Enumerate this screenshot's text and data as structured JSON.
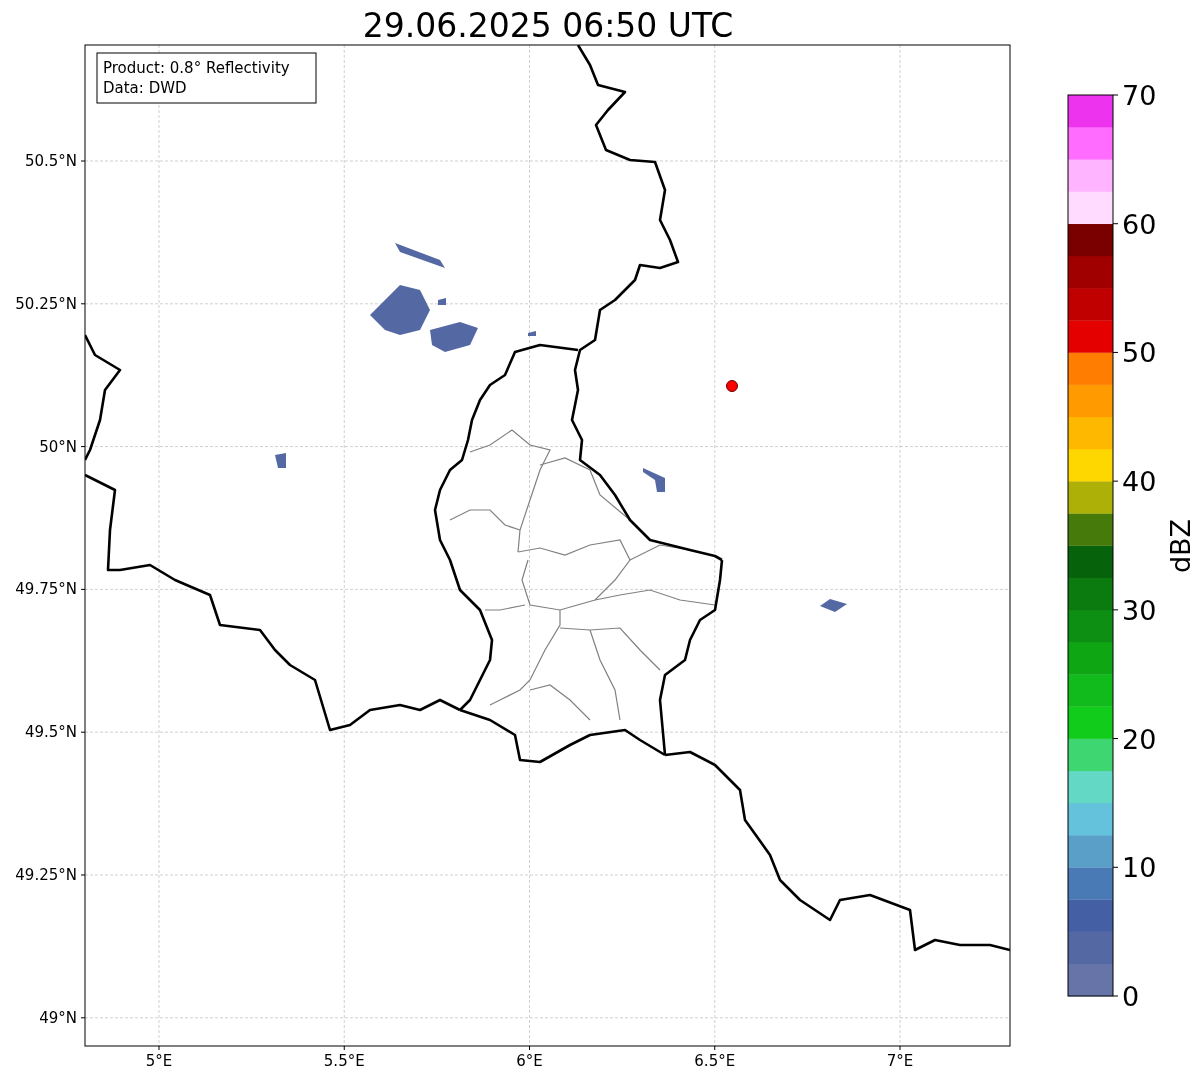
{
  "title": "29.06.2025 06:50 UTC",
  "info_box": [
    "Product: 0.8° Reflectivity",
    "Data: DWD"
  ],
  "map": {
    "lat_ticks": [
      "50.5°N",
      "50.25°N",
      "50°N",
      "49.75°N",
      "49.5°N",
      "49.25°N",
      "49°N"
    ],
    "lon_ticks": [
      "5°E",
      "5.5°E",
      "6°E",
      "6.5°E",
      "7°E"
    ]
  },
  "colorbar": {
    "label": "dBZ",
    "ticks": [
      "70",
      "60",
      "50",
      "40",
      "30",
      "20",
      "10",
      "0"
    ],
    "segments": [
      {
        "color": "#6674a8"
      },
      {
        "color": "#5468a3"
      },
      {
        "color": "#445fa3"
      },
      {
        "color": "#4a7ab5"
      },
      {
        "color": "#5a9fc8"
      },
      {
        "color": "#65c2dc"
      },
      {
        "color": "#63d8c4"
      },
      {
        "color": "#3ed670"
      },
      {
        "color": "#11cc1b"
      },
      {
        "color": "#11bb1b"
      },
      {
        "color": "#0fa614"
      },
      {
        "color": "#0c8f12"
      },
      {
        "color": "#0b7b10"
      },
      {
        "color": "#06620b"
      },
      {
        "color": "#467a0b"
      },
      {
        "color": "#adb006"
      },
      {
        "color": "#ffd700"
      },
      {
        "color": "#ffb800"
      },
      {
        "color": "#ff9b00"
      },
      {
        "color": "#ff7d00"
      },
      {
        "color": "#e50000"
      },
      {
        "color": "#c00000"
      },
      {
        "color": "#a00000"
      },
      {
        "color": "#7a0000"
      },
      {
        "color": "#ffdcff"
      },
      {
        "color": "#ffb4ff"
      },
      {
        "color": "#ff6cff"
      },
      {
        "color": "#ee33ee"
      }
    ]
  }
}
